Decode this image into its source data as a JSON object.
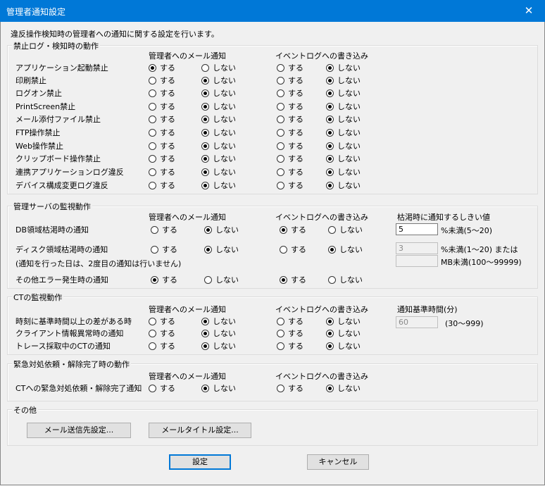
{
  "window": {
    "title": "管理者通知設定",
    "close": "✕"
  },
  "description": "違反操作検知時の管理者への通知に関する設定を行います。",
  "col_mail": "管理者へのメール通知",
  "col_event": "イベントログへの書き込み",
  "opt_on": "する",
  "opt_off": "しない",
  "group1": {
    "title": "禁止ログ・検知時の動作",
    "rows": [
      {
        "label": "アプリケーション起動禁止",
        "mail": "on",
        "event": "off"
      },
      {
        "label": "印刷禁止",
        "mail": "off",
        "event": "off"
      },
      {
        "label": "ログオン禁止",
        "mail": "off",
        "event": "off"
      },
      {
        "label": "PrintScreen禁止",
        "mail": "off",
        "event": "off"
      },
      {
        "label": "メール添付ファイル禁止",
        "mail": "off",
        "event": "off"
      },
      {
        "label": "FTP操作禁止",
        "mail": "off",
        "event": "off"
      },
      {
        "label": "Web操作禁止",
        "mail": "off",
        "event": "off"
      },
      {
        "label": "クリップボード操作禁止",
        "mail": "off",
        "event": "off"
      },
      {
        "label": "連携アプリケーションログ違反",
        "mail": "off",
        "event": "off"
      },
      {
        "label": "デバイス構成変更ログ違反",
        "mail": "off",
        "event": "off"
      }
    ]
  },
  "group2": {
    "title": "管理サーバの監視動作",
    "threshold_header": "枯渇時に通知するしきい値",
    "rows": [
      {
        "label": "DB領域枯渇時の通知",
        "mail": "off",
        "event": "on"
      },
      {
        "label": "ディスク領域枯渇時の通知",
        "mail": "off",
        "event": "off"
      },
      {
        "label": "その他エラー発生時の通知",
        "mail": "on",
        "event": "on"
      }
    ],
    "disk_note": "(通知を行った日は、2度目の通知は行いません)",
    "db_threshold": "5",
    "db_unit": "%未満(5〜20)",
    "disk_threshold": "3",
    "disk_unit": "%未満(1〜20) または",
    "disk_mb": "",
    "disk_mb_unit": "MB未満(100〜99999)"
  },
  "group3": {
    "title": "CTの監視動作",
    "time_header": "通知基準時間(分)",
    "rows": [
      {
        "label": "時刻に基準時間以上の差がある時",
        "mail": "off",
        "event": "off"
      },
      {
        "label": "クライアント情報異常時の通知",
        "mail": "off",
        "event": "off"
      },
      {
        "label": "トレース採取中のCTの通知",
        "mail": "off",
        "event": "off"
      }
    ],
    "time_value": "60",
    "time_unit": "(30〜999)"
  },
  "group4": {
    "title": "緊急対処依頼・解除完了時の動作",
    "rows": [
      {
        "label": "CTへの緊急対処依頼・解除完了通知",
        "mail": "off",
        "event": "off"
      }
    ]
  },
  "group5": {
    "title": "その他",
    "mail_dest_button": "メール送信先設定...",
    "mail_title_button": "メールタイトル設定..."
  },
  "buttons": {
    "ok": "設定",
    "cancel": "キャンセル"
  }
}
